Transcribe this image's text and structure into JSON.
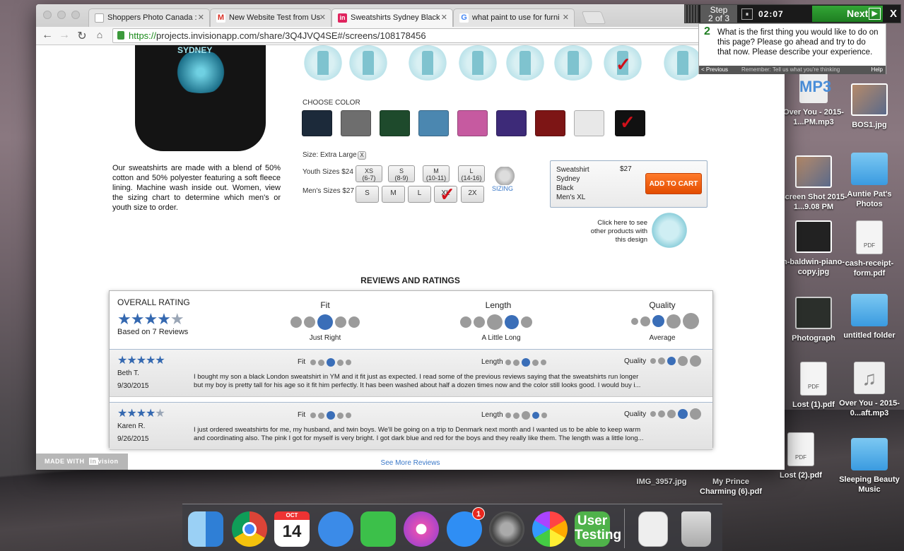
{
  "browser": {
    "tabs": [
      {
        "label": "Shoppers Photo Canada :",
        "favicon": "generic",
        "active": false
      },
      {
        "label": "New Website Test from Us",
        "favicon": "M",
        "active": false
      },
      {
        "label": "Sweatshirts Sydney Black",
        "favicon": "in",
        "active": true
      },
      {
        "label": "what paint to use for furni",
        "favicon": "G",
        "active": false
      }
    ],
    "url_scheme": "https://",
    "url_rest": "projects.invisionapp.com/share/3Q4JVQ4SE#/screens/108178456"
  },
  "product": {
    "print_label": "SYDNEY",
    "choose_color_label": "CHOOSE COLOR",
    "colors": [
      "#1c2a3a",
      "#6e6e6e",
      "#1e4a2c",
      "#4b87b0",
      "#c65aa0",
      "#3d2a78",
      "#7d1515",
      "#e8e8e8",
      "#111111"
    ],
    "selected_color_check": "✓",
    "size_label": "Size: Extra Large",
    "size_clear": "X",
    "youth_label": "Youth Sizes $24",
    "youth_sizes": [
      {
        "top": "XS",
        "bottom": "(6-7)"
      },
      {
        "top": "S",
        "bottom": "(8-9)"
      },
      {
        "top": "M",
        "bottom": "(10-11)"
      },
      {
        "top": "L",
        "bottom": "(14-16)"
      }
    ],
    "mens_label": "Men's Sizes $27",
    "mens_sizes": [
      "S",
      "M",
      "L",
      "XL",
      "2X"
    ],
    "sizing_link": "SIZING",
    "description": "Our sweatshirts are made with a blend of 50% cotton and 50% polyester featuring a soft fleece lining. Machine wash inside out. Women, view the sizing chart to determine which men's or youth size to order."
  },
  "cart": {
    "line1": "Sweatshirt",
    "line2": "Sydney",
    "line3": "Black",
    "line4": "Men's XL",
    "price": "$27",
    "add_button": "ADD TO CART"
  },
  "other_products": "Click here to see other products with this design",
  "reviews": {
    "title": "REVIEWS AND RATINGS",
    "overall_title": "OVERALL RATING",
    "overall_stars": 4.5,
    "based_on": "Based on 7 Reviews",
    "fit_title": "Fit",
    "fit_sub": "Just Right",
    "length_title": "Length",
    "length_sub": "A Little Long",
    "quality_title": "Quality",
    "quality_sub": "Average",
    "items": [
      {
        "stars": 5,
        "name": "Beth T.",
        "date": "9/30/2015",
        "fit_label": "Fit",
        "length_label": "Length",
        "quality_label": "Quality",
        "text1": "I bought my son a black London sweatshirt in YM and it fit just as expected. I read some of the previous reviews saying that the sweatshirts run longer",
        "text2": "but my boy is pretty tall for his age so it fit him perfectly. It has been washed about half a dozen times now and the color still looks good. I would buy i..."
      },
      {
        "stars": 4.5,
        "name": "Karen R.",
        "date": "9/26/2015",
        "fit_label": "Fit",
        "length_label": "Length",
        "quality_label": "Quality",
        "text1": "I just ordered sweatshirts for me, my husband, and twin boys. We'll be going on a trip to Denmark next month and I wanted us to be able to keep warm",
        "text2": "and coordinating also. The pink I got for myself is very bright. I got dark blue and red for the boys and they really like them. The length was a little long..."
      }
    ],
    "see_more": "See More Reviews"
  },
  "madewith": {
    "prefix": "MADE WITH",
    "brand_in": "in",
    "brand_rest": "vision"
  },
  "usertesting": {
    "step_line1": "Step",
    "step_line2": "2 of 3",
    "pause_icon": "⏸",
    "timer": "02:07",
    "next_label": "Next",
    "next_arrow": "▶",
    "close": "X",
    "task_number": "2",
    "question": "What is the first thing you would like to do on this page? Please go ahead and try to do that now. Please describe your experience.",
    "previous": "< Previous",
    "reminder": "Remember: Tell us what you're thinking",
    "help": "Help"
  },
  "desktop": {
    "icons": [
      {
        "label": "Over You - 2015-1...PM.mp3",
        "kind": "mp3",
        "glyph": "MP3"
      },
      {
        "label": "BOS1.jpg",
        "kind": "img"
      },
      {
        "label": "Screen Shot 2015-1...9.08 PM",
        "kind": "img"
      },
      {
        "label": "Auntie Pat's Photos",
        "kind": "folder"
      },
      {
        "label": "n-baldwin-piano-copy.jpg",
        "kind": "piano"
      },
      {
        "label": "cash-receipt-form.pdf",
        "kind": "doc"
      },
      {
        "label": "Photograph",
        "kind": "term"
      },
      {
        "label": "untitled folder",
        "kind": "folder"
      },
      {
        "label": "Lost (1).pdf",
        "kind": "doc"
      },
      {
        "label": "Over You - 2015-0...aft.mp3",
        "kind": "music",
        "glyph": "♫"
      },
      {
        "label": "IMG_3957.jpg",
        "kind": "none"
      },
      {
        "label": "My Prince Charming (6).pdf",
        "kind": "none"
      },
      {
        "label": "Lost (2).pdf",
        "kind": "doc"
      },
      {
        "label": "Sleeping Beauty Music",
        "kind": "folder"
      }
    ]
  },
  "dock": {
    "calendar_month": "OCT",
    "calendar_day": "14",
    "appstore_badge": "1",
    "usertesting_line1": "User",
    "usertesting_line2": "Testing"
  }
}
